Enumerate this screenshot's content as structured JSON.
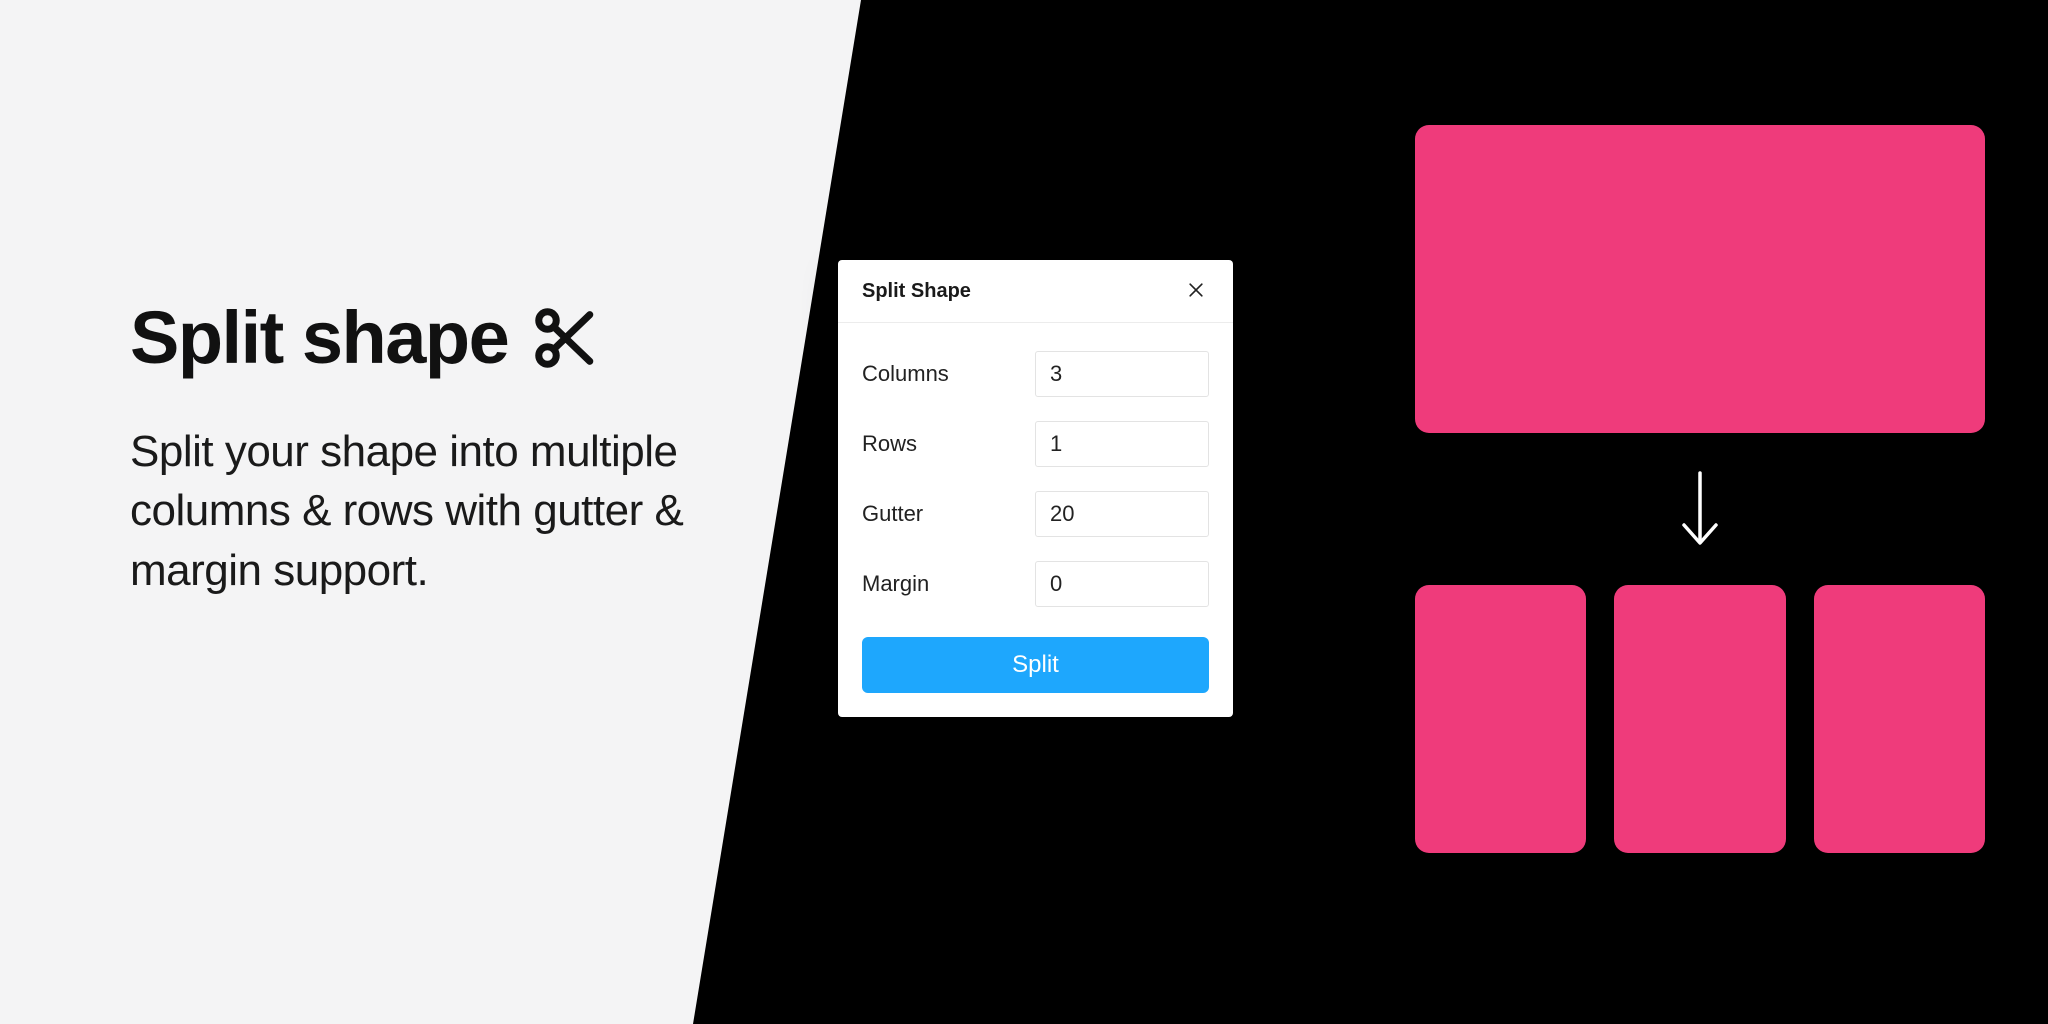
{
  "hero": {
    "title": "Split shape",
    "description": "Split your shape into multiple columns & rows with gutter & margin support."
  },
  "panel": {
    "title": "Split Shape",
    "fields": {
      "columns": {
        "label": "Columns",
        "value": "3"
      },
      "rows": {
        "label": "Rows",
        "value": "1"
      },
      "gutter": {
        "label": "Gutter",
        "value": "20"
      },
      "margin": {
        "label": "Margin",
        "value": "0"
      }
    },
    "action_label": "Split"
  },
  "colors": {
    "accent_pink": "#ef3b7b",
    "accent_blue": "#1ea7fd"
  }
}
